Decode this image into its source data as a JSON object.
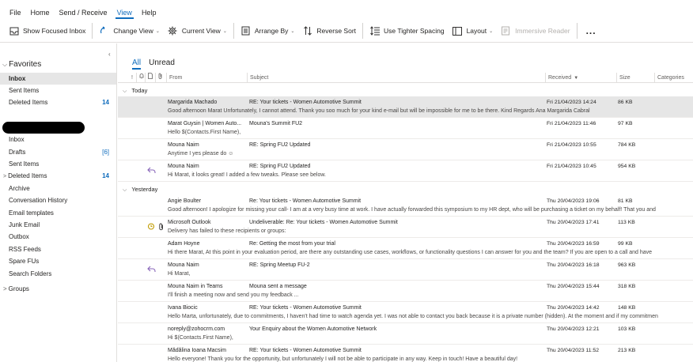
{
  "menu": {
    "tabs": [
      {
        "label": "File"
      },
      {
        "label": "Home"
      },
      {
        "label": "Send / Receive"
      },
      {
        "label": "View"
      },
      {
        "label": "Help"
      }
    ]
  },
  "ribbon": {
    "show_focused_inbox": "Show Focused Inbox",
    "change_view": "Change View",
    "current_view": "Current View",
    "arrange_by": "Arrange By",
    "reverse_sort": "Reverse Sort",
    "use_tighter_spacing": "Use Tighter Spacing",
    "layout": "Layout",
    "immersive_reader": "Immersive Reader",
    "more": "..."
  },
  "nav": {
    "collapse": "‹",
    "favorites": {
      "label": "Favorites",
      "items": [
        {
          "label": "Inbox",
          "count": ""
        },
        {
          "label": "Sent Items",
          "count": ""
        },
        {
          "label": "Deleted Items",
          "count": "14"
        }
      ]
    },
    "account": {
      "folders": [
        {
          "label": "Inbox",
          "count": ""
        },
        {
          "label": "Drafts",
          "count": "[6]"
        },
        {
          "label": "Sent Items",
          "count": ""
        },
        {
          "label": "Deleted Items",
          "count": "14"
        },
        {
          "label": "Archive",
          "count": ""
        },
        {
          "label": "Conversation History",
          "count": ""
        },
        {
          "label": "Email templates",
          "count": ""
        },
        {
          "label": "Junk Email",
          "count": ""
        },
        {
          "label": "Outbox",
          "count": ""
        },
        {
          "label": "RSS Feeds",
          "count": ""
        },
        {
          "label": "Spare FUs",
          "count": ""
        },
        {
          "label": "Search Folders",
          "count": ""
        }
      ]
    },
    "groups": "Groups"
  },
  "list": {
    "filters": [
      {
        "label": "All"
      },
      {
        "label": "Unread"
      }
    ],
    "columns": {
      "importance": "!",
      "reminder": "",
      "type": "",
      "attachment": "",
      "from": "From",
      "subject": "Subject",
      "received": "Received",
      "size": "Size",
      "categories": "Categories"
    },
    "groups": [
      {
        "label": "Today",
        "emails": [
          {
            "from": "Margarida Machado",
            "subject": "RE: Your tickets - Women Automotive Summit",
            "received": "Fri 21/04/2023 14:24",
            "size": "86 KB",
            "preview": "Good afternoon Marat   Unfortunately, I cannot attend. Thank you soo much for your kind e-mail but will be impossible for me to be there.  Kind Regards  Ana Margarida Cabral",
            "selected": true,
            "replied": false,
            "meeting": false,
            "attachment": false
          },
          {
            "from": "Marat Guysin | Women Auto...",
            "subject": "Mouna's Summit FU2",
            "received": "Fri 21/04/2023 11:46",
            "size": "97 KB",
            "preview": "Hello $(Contacts.First Name),",
            "selected": false,
            "replied": false,
            "meeting": false,
            "attachment": false
          },
          {
            "from": "Mouna Naim",
            "subject": "RE: Spring FU2 Updated",
            "received": "Fri 21/04/2023 10:55",
            "size": "784 KB",
            "preview": "Anytime I yes please do ☺",
            "selected": false,
            "replied": false,
            "meeting": false,
            "attachment": false
          },
          {
            "from": "Mouna Naim",
            "subject": "RE: Spring FU2 Updated",
            "received": "Fri 21/04/2023 10:45",
            "size": "954 KB",
            "preview": "Hi Marat, it looks great!  I added a few tweaks. Please see below.",
            "selected": false,
            "replied": true,
            "meeting": false,
            "attachment": false
          }
        ]
      },
      {
        "label": "Yesterday",
        "emails": [
          {
            "from": "Angie Boulter",
            "subject": "Re: Your tickets - Women Automotive Summit",
            "received": "Thu 20/04/2023 19:06",
            "size": "81 KB",
            "preview": "Good afternoon!  I apologize for missing your call- I am at a very busy time at work.  I have actually forwarded this symposium to my HR dept, who will be purchasing a ticket on my behalf!  That you and",
            "selected": false,
            "replied": false,
            "meeting": false,
            "attachment": false
          },
          {
            "from": "Microsoft Outlook",
            "subject": "Undeliverable: Re: Your tickets - Women Automotive Summit",
            "received": "Thu 20/04/2023 17:41",
            "size": "113 KB",
            "preview": "Delivery has failed to these recipients or groups:",
            "selected": false,
            "replied": false,
            "meeting": true,
            "attachment": true
          },
          {
            "from": "Adam Hoyne",
            "subject": "Re: Getting the most from your trial",
            "received": "Thu 20/04/2023 16:59",
            "size": "99 KB",
            "preview": "Hi there Marat,  At this point in your evaluation period, are there any outstanding use cases, workflows, or functionality questions I can answer for you and the team?   If you are open to a call and have",
            "selected": false,
            "replied": false,
            "meeting": false,
            "attachment": false
          },
          {
            "from": "Mouna Naim",
            "subject": "RE: Spring Meetup FU-2",
            "received": "Thu 20/04/2023 16:18",
            "size": "963 KB",
            "preview": "Hi Marat,",
            "selected": false,
            "replied": true,
            "meeting": false,
            "attachment": false
          },
          {
            "from": "Mouna Naim in Teams",
            "subject": "Mouna sent a message",
            "received": "Thu 20/04/2023 15:44",
            "size": "318 KB",
            "preview": "I'll finish a meeting now and send you my feedback                                                               ...",
            "selected": false,
            "replied": false,
            "meeting": false,
            "attachment": false
          },
          {
            "from": "Ivana Biocic",
            "subject": "RE: Your tickets - Women Automotive Summit",
            "received": "Thu 20/04/2023 14:42",
            "size": "148 KB",
            "preview": "Hello Marta,  unfortunately, due to commitments, I haven't had time to watch agenda yet. I was not able to contact you back because it is a private number (hidden).  At the moment and if my commitmen",
            "selected": false,
            "replied": false,
            "meeting": false,
            "attachment": false
          },
          {
            "from": "noreply@zohocrm.com",
            "subject": "Your Enquiry about the Women Automotive Network",
            "received": "Thu 20/04/2023 12:21",
            "size": "103 KB",
            "preview": "Hi $(Contacts.First Name),",
            "selected": false,
            "replied": false,
            "meeting": false,
            "attachment": false
          },
          {
            "from": "Mădălina Ioana Macsim",
            "subject": "RE: Your tickets - Women Automotive Summit",
            "received": "Thu 20/04/2023 11:52",
            "size": "213 KB",
            "preview": "Hello everyone!  Thank you for the opportunity, but unfortunately I will not be able to participate in any way.   Keep in touch!  Have a beautiful day!",
            "selected": false,
            "replied": false,
            "meeting": false,
            "attachment": false
          }
        ]
      }
    ]
  },
  "colors": {
    "accent": "#0f6cbd",
    "selected_row": "#e6e6e6",
    "replied_icon": "#8764b8",
    "meeting_icon": "#c19c00"
  },
  "icons": {
    "focused_inbox": "inbox-icon",
    "change_view": "change-view-icon",
    "current_view": "gear-icon",
    "arrange_by": "arrange-icon",
    "reverse_sort": "sort-arrows-icon",
    "tighter_spacing": "spacing-icon",
    "layout": "layout-icon",
    "immersive_reader": "reader-icon",
    "reply": "reply-arrow-icon",
    "meeting": "meeting-icon",
    "attachment": "paperclip-icon"
  }
}
